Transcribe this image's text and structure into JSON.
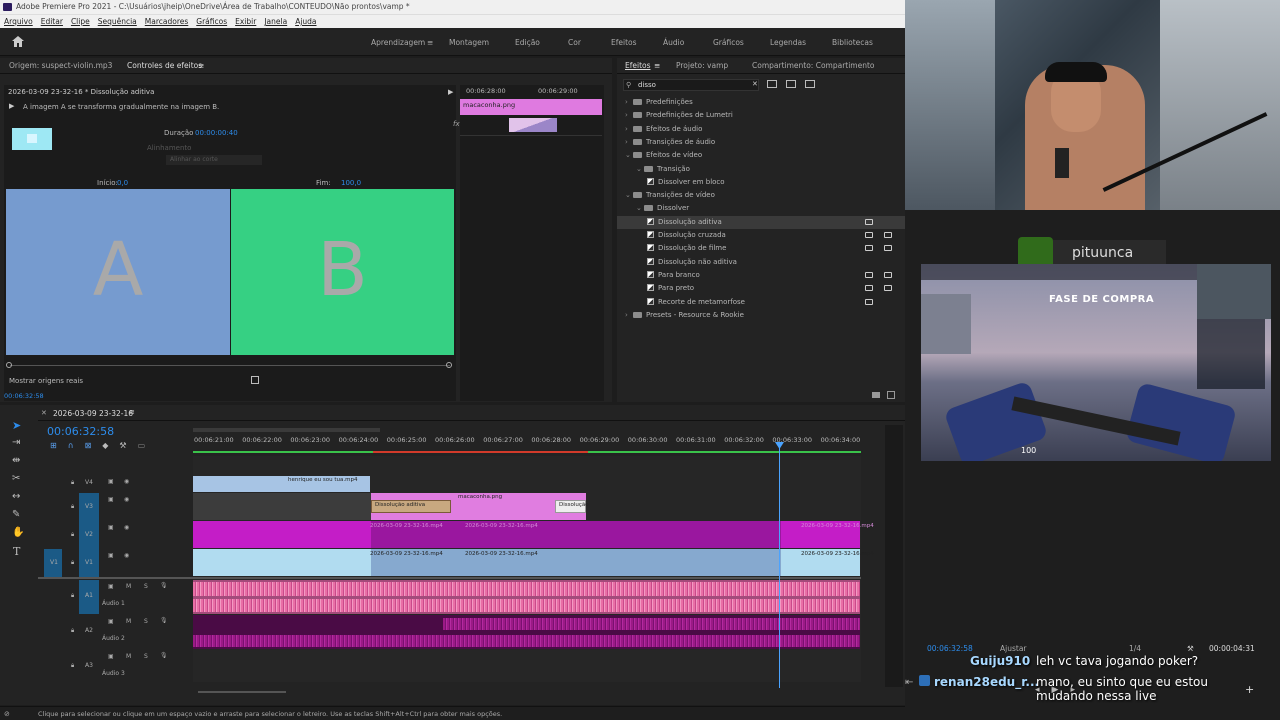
{
  "titlebar": {
    "title": "Adobe Premiere Pro 2021 - C:\\Usuários\\jheip\\OneDrive\\Área de Trabalho\\CONTEUDO\\Não prontos\\vamp *"
  },
  "menu": [
    "Arquivo",
    "Editar",
    "Clipe",
    "Sequência",
    "Marcadores",
    "Gráficos",
    "Exibir",
    "Janela",
    "Ajuda"
  ],
  "workspaces": {
    "learn": "Aprendizagem",
    "assembly": "Montagem",
    "edit": "Edição",
    "color": "Cor",
    "effects": "Efeitos",
    "audio": "Áudio",
    "graphics": "Gráficos",
    "captions": "Legendas",
    "libraries": "Bibliotecas"
  },
  "effect_controls": {
    "source_tab": "Origem: suspect-violin.mp3",
    "active_tab": "Controles de efeitos",
    "header": "2026-03-09 23-32-16 * Dissolução aditiva",
    "description": "A imagem A se transforma gradualmente na imagem B.",
    "duration_label": "Duração",
    "duration_value": "00:00:00:40",
    "alignment_label": "Alinhamento",
    "alignment_value": "Alinhar ao corte",
    "start_label": "Início:",
    "start_value": "0,0",
    "end_label": "Fim:",
    "end_value": "100,0",
    "a_label": "A",
    "b_label": "B",
    "show_sources": "Mostrar origens reais",
    "timecode": "00:06:32:58",
    "mini_t1": "00:06:28:00",
    "mini_t2": "00:06:29:00",
    "mini_clip": "macaconha.png"
  },
  "effects_panel": {
    "tabs": [
      "Efeitos",
      "Projeto: vamp",
      "Compartimento: Compartimento"
    ],
    "search_value": "disso",
    "tree": [
      {
        "label": "Predefinições",
        "depth": 0,
        "kind": "folder",
        "open": false
      },
      {
        "label": "Predefinições de Lumetri",
        "depth": 0,
        "kind": "folder",
        "open": false
      },
      {
        "label": "Efeitos de áudio",
        "depth": 0,
        "kind": "folder",
        "open": false
      },
      {
        "label": "Transições de áudio",
        "depth": 0,
        "kind": "folder",
        "open": false
      },
      {
        "label": "Efeitos de vídeo",
        "depth": 0,
        "kind": "folder",
        "open": true
      },
      {
        "label": "Transição",
        "depth": 1,
        "kind": "folder",
        "open": true
      },
      {
        "label": "Dissolver em bloco",
        "depth": 2,
        "kind": "fx"
      },
      {
        "label": "Transições de vídeo",
        "depth": 0,
        "kind": "folder",
        "open": true
      },
      {
        "label": "Dissolver",
        "depth": 1,
        "kind": "folder",
        "open": true
      },
      {
        "label": "Dissolução aditiva",
        "depth": 2,
        "kind": "fx",
        "selected": true,
        "badges": 1
      },
      {
        "label": "Dissolução cruzada",
        "depth": 2,
        "kind": "fx",
        "badges": 2
      },
      {
        "label": "Dissolução de filme",
        "depth": 2,
        "kind": "fx",
        "badges": 2
      },
      {
        "label": "Dissolução não aditiva",
        "depth": 2,
        "kind": "fx"
      },
      {
        "label": "Para branco",
        "depth": 2,
        "kind": "fx",
        "badges": 2
      },
      {
        "label": "Para preto",
        "depth": 2,
        "kind": "fx",
        "badges": 2
      },
      {
        "label": "Recorte de metamorfose",
        "depth": 2,
        "kind": "fx",
        "badges": 1
      },
      {
        "label": "Presets - Resource & Rookie",
        "depth": 0,
        "kind": "folder",
        "open": false
      }
    ]
  },
  "timeline": {
    "sequence_name": "2026-03-09 23-32-16",
    "timecode": "00:06:32:58",
    "ruler": [
      "00:06:21:00",
      "00:06:22:00",
      "00:06:23:00",
      "00:06:24:00",
      "00:06:25:00",
      "00:06:26:00",
      "00:06:27:00",
      "00:06:28:00",
      "00:06:29:00",
      "00:06:30:00",
      "00:06:31:00",
      "00:06:32:00",
      "00:06:33:00",
      "00:06:34:00"
    ],
    "tracks": {
      "v4": "V4",
      "v3": "V3",
      "v2": "V2",
      "v1": "V1",
      "v1src": "V1",
      "a1": "A1",
      "a2": "A2",
      "a3": "A3",
      "audio1": "Áudio 1",
      "audio2": "Áudio 2",
      "audio3": "Áudio 3",
      "m": "M",
      "s": "S"
    },
    "clips": {
      "v4": "henrique eu sou tua.mp4",
      "v3_trans1": "Dissolução aditiva",
      "v3_png": "macaconha.png",
      "v3_trans2": "Dissolução",
      "v2a": "2026-03-09 23-32-16.mp4",
      "v2b": "2026-03-09 23-32-16.mp4",
      "v2c": "2026-03-09 23-32-16.mp4",
      "v1a": "2026-03-09 23-32-16.mp4",
      "v1b": "2026-03-09 23-32-16.mp4",
      "v1c": "2026-03-09 23-32-16.mp4"
    }
  },
  "status_bar": "Clique para selecionar ou clique em um espaço vazio e arraste para selecionar o letreiro. Use as teclas Shift+Alt+Ctrl para obter mais opções.",
  "program_monitor": {
    "timecode": "00:06:32:58",
    "fit": "Ajustar",
    "quality": "1/4",
    "duration": "00:00:04:31"
  },
  "stream": {
    "streamer_name": "pituunca",
    "game_banner": "FASE DE COMPRA",
    "health": "100"
  },
  "chat": [
    {
      "user": "Guiju910",
      "message": "leh vc tava jogando poker?"
    },
    {
      "user": "renan28edu_r...",
      "message": "mano, eu sinto que eu estou mudando nessa live"
    }
  ],
  "colors": {
    "accent": "#2d8ceb",
    "video_clip": "#a7c4e4",
    "pink_clip": "#e07de0",
    "magenta_track": "#c41dc7",
    "audio_wave": "#e96fa6",
    "playhead": "#4aa3ff",
    "timeline_green": "#3ac24a"
  }
}
